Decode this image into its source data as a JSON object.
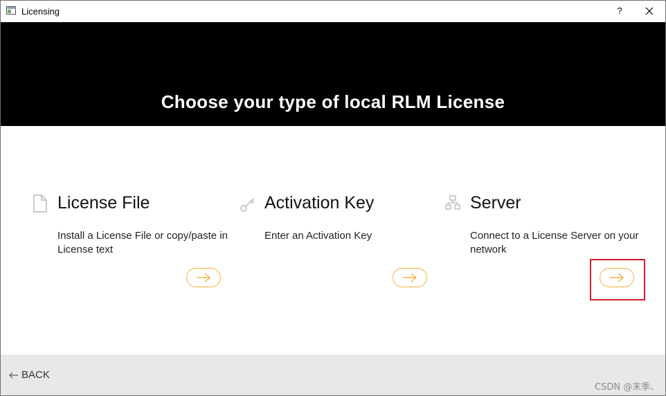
{
  "window": {
    "title": "Licensing",
    "help_label": "?"
  },
  "header": {
    "title": "Choose your type of local RLM License",
    "background": "#000000"
  },
  "options": [
    {
      "icon": "document-icon",
      "title": "License File",
      "description": "Install a License File or copy/paste in License text"
    },
    {
      "icon": "key-icon",
      "title": "Activation Key",
      "description": "Enter an Activation Key"
    },
    {
      "icon": "network-server-icon",
      "title": "Server",
      "description": "Connect to a License Server on your network"
    }
  ],
  "footer": {
    "back_label": "BACK",
    "watermark": "CSDN @末季、"
  },
  "colors": {
    "accent": "#f2b13a",
    "highlight_box": "#d0192b",
    "footer_bg": "#e8e8e8"
  }
}
